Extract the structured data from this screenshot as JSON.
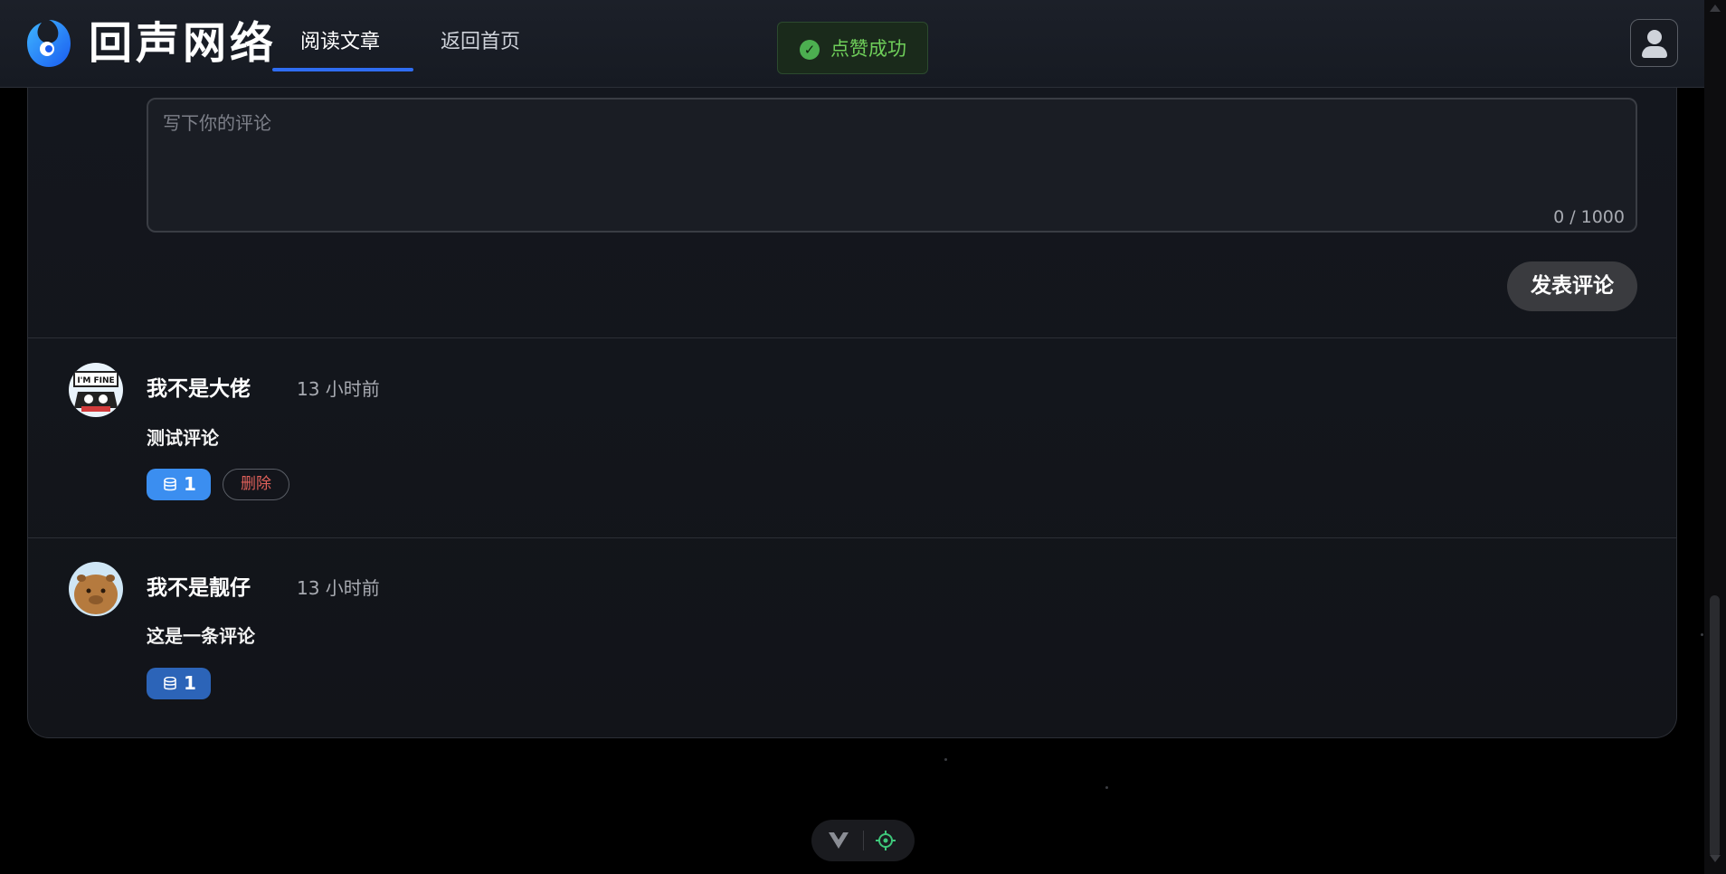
{
  "header": {
    "logo_text": "回声网络",
    "tabs": [
      {
        "label": "阅读文章",
        "active": true
      },
      {
        "label": "返回首页",
        "active": false
      }
    ]
  },
  "toast": {
    "message": "点赞成功",
    "type": "success",
    "color": "#6fcf5a"
  },
  "comment_form": {
    "placeholder": "写下你的评论",
    "counter": "0 / 1000",
    "submit_label": "发表评论"
  },
  "comments": [
    {
      "author": "我不是大佬",
      "time": "13 小时前",
      "content": "测试评论",
      "likes": "1",
      "like_color": "#3b8ef0",
      "avatar_text": "I'M FINE",
      "delete_label": "删除"
    },
    {
      "author": "我不是靓仔",
      "time": "13 小时前",
      "content": "这是一条评论",
      "likes": "1",
      "like_color": "#2c64b8",
      "avatar_kind": "capybara"
    }
  ],
  "colors": {
    "accent": "#2f6df2",
    "danger": "#e0605a",
    "background": "#000000"
  },
  "icons": [
    "logo-icon",
    "check-circle-icon",
    "user-icon",
    "database-icon",
    "vue-icon",
    "target-icon",
    "scroll-up-arrow-icon",
    "scroll-down-arrow-icon"
  ]
}
